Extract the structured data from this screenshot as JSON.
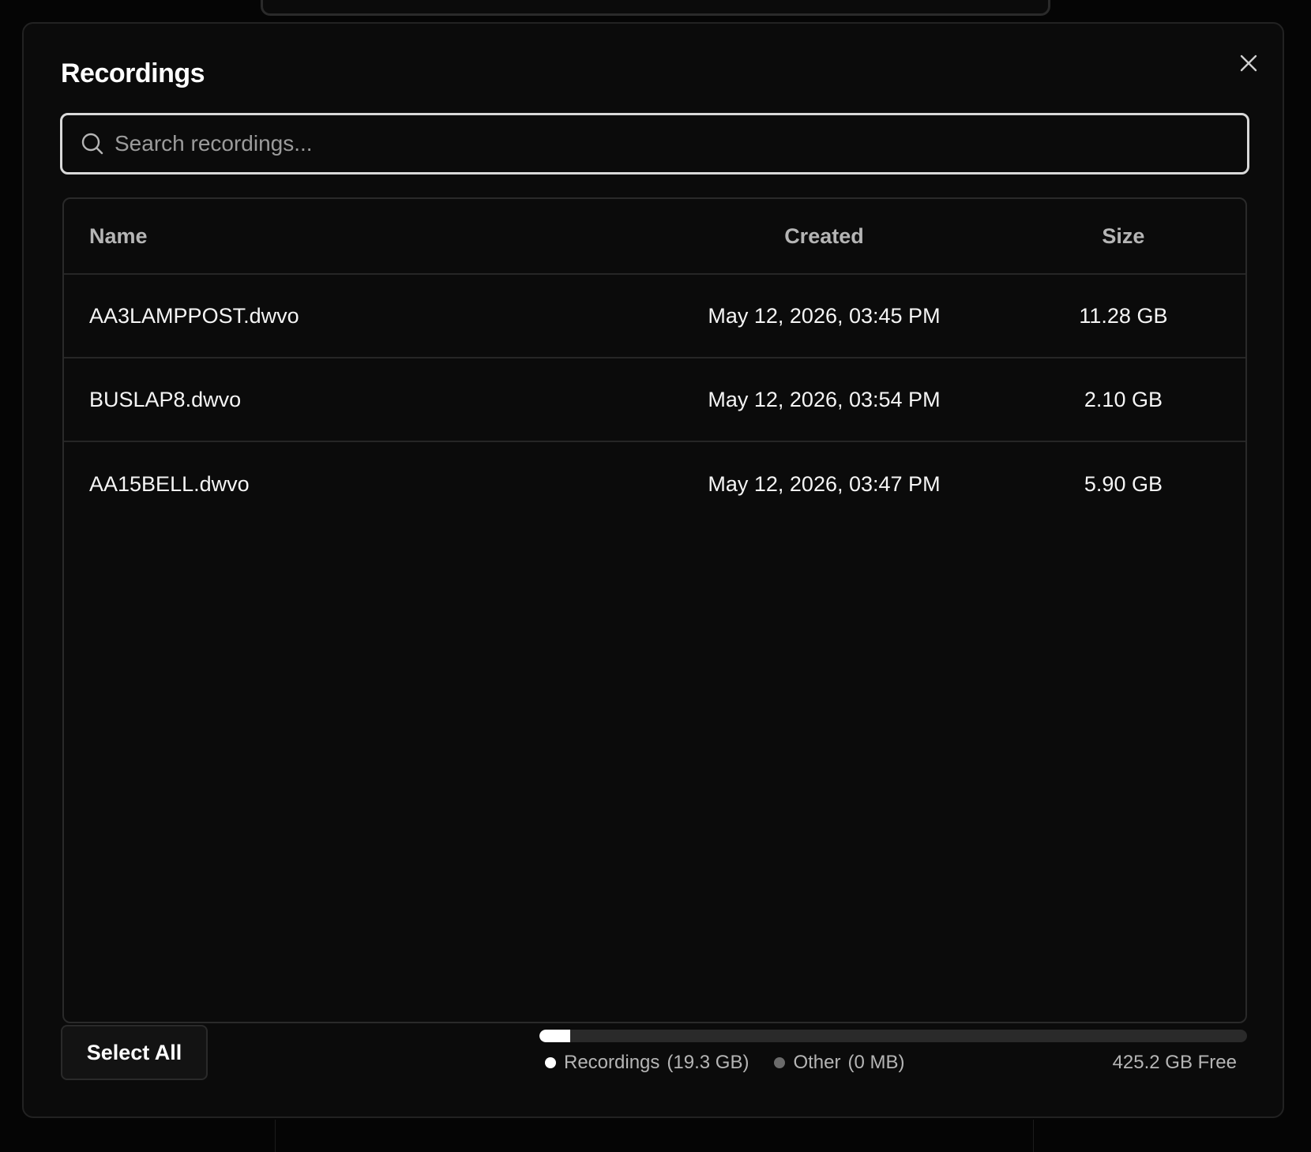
{
  "modal": {
    "title": "Recordings"
  },
  "search": {
    "placeholder": "Search recordings..."
  },
  "table": {
    "headers": {
      "name": "Name",
      "created": "Created",
      "size": "Size"
    },
    "rows": [
      {
        "name": "AA3LAMPPOST.dwvo",
        "created": "May 12, 2026, 03:45 PM",
        "size": "11.28 GB"
      },
      {
        "name": "BUSLAP8.dwvo",
        "created": "May 12, 2026, 03:54 PM",
        "size": "2.10 GB"
      },
      {
        "name": "AA15BELL.dwvo",
        "created": "May 12, 2026, 03:47 PM",
        "size": "5.90 GB"
      }
    ]
  },
  "footer": {
    "select_all_label": "Select All",
    "storage": {
      "used_fraction": 0.043,
      "recordings_label": "Recordings",
      "recordings_value": "(19.3 GB)",
      "other_label": "Other",
      "other_value": "(0 MB)",
      "free_label": "425.2 GB Free",
      "recordings_color": "#ffffff",
      "other_color": "#6b6b6b"
    }
  },
  "icons": {
    "close": "close-icon",
    "search": "search-icon"
  },
  "colors": {
    "background": "#050505",
    "modal_bg": "#0b0b0b",
    "border": "#2a2a2a",
    "text_primary": "#f5f5f5",
    "text_muted": "#b5b5b5"
  }
}
